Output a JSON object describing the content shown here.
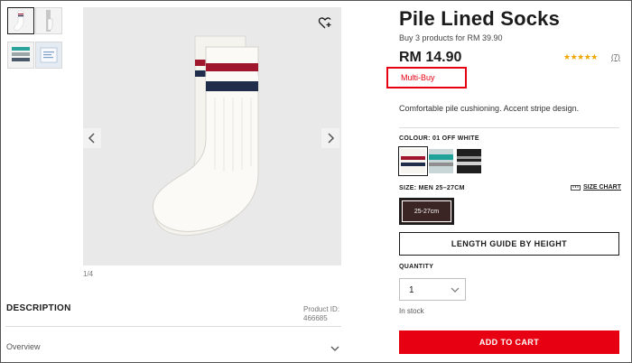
{
  "product": {
    "title": "Pile Lined Socks",
    "promo": "Buy 3 products for RM 39.90",
    "price": "RM 14.90",
    "rating_stars": "★★★★★",
    "rating": 5,
    "review_count": "(7)",
    "badge": "Multi-Buy",
    "features": "Comfortable pile cushioning. Accent stripe design."
  },
  "gallery": {
    "counter": "1/4",
    "thumbnails": [
      "thumb-1",
      "thumb-2",
      "thumb-3",
      "thumb-4"
    ]
  },
  "colour": {
    "label": "COLOUR: 01 OFF WHITE",
    "swatches": [
      {
        "name": "off-white",
        "stripe1": "#a0162d",
        "stripe2": "#1f2c4a",
        "selected": true
      },
      {
        "name": "green",
        "stripe1": "#1ea29a",
        "stripe2": "#8f8f8f",
        "selected": false
      },
      {
        "name": "black",
        "stripe1": "#9a9a9a",
        "stripe2": "#d0d0d0",
        "selected": false
      }
    ]
  },
  "size": {
    "label": "SIZE: MEN 25–27CM",
    "guide_label": "SIZE CHART",
    "options": [
      "25-27cm"
    ]
  },
  "length_guide_label": "LENGTH GUIDE BY HEIGHT",
  "quantity": {
    "label": "QUANTITY",
    "value": "1"
  },
  "stock_status": "In stock",
  "add_to_cart_label": "ADD TO CART",
  "description": {
    "title": "DESCRIPTION",
    "product_id_label": "Product ID:",
    "product_id": "466685",
    "overview_label": "Overview"
  },
  "colors": {
    "accent": "#e60012",
    "star": "#f0a500",
    "selected_size_bg": "#3a2524"
  }
}
